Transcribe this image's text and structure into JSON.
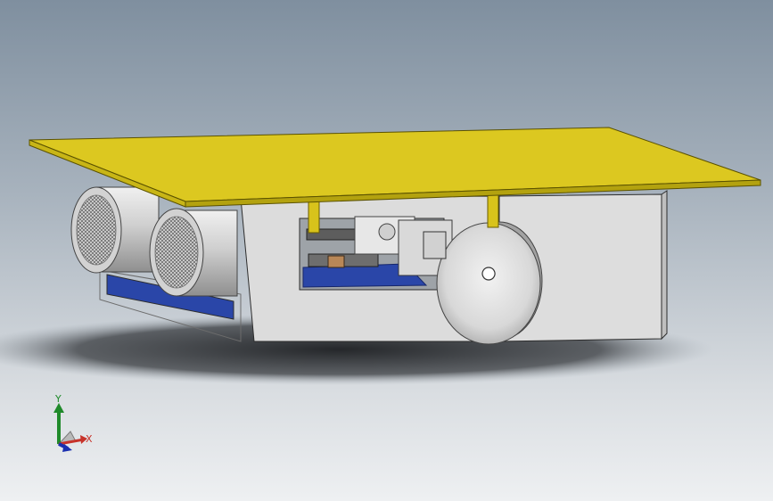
{
  "viewport": {
    "background_colors": [
      "#7f8f9f",
      "#eef0f2"
    ]
  },
  "model": {
    "plate_color": "#dcc820",
    "body_color": "#dcdcdc",
    "pcb_color": "#2a46a8",
    "sensor_color": "#c8c8c8"
  },
  "triad": {
    "y_label": "Y",
    "x_label": "X",
    "y_color": "#1f8a2a",
    "x_color": "#c7332b",
    "z_color": "#1a2fb0"
  }
}
